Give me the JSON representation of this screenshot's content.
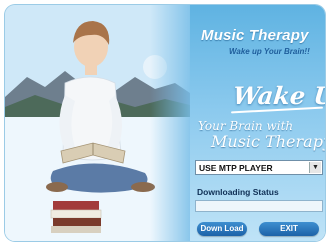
{
  "header": {
    "title": "Music Therapy",
    "subtitle": "Wake up Your Brain!!"
  },
  "slogan": {
    "headline": "Wake Up!",
    "line1": "Your Brain with",
    "line2": "Music Therapy"
  },
  "player_select": {
    "selected": "USE MTP PLAYER"
  },
  "status": {
    "label": "Downloading Status",
    "progress": 0
  },
  "buttons": {
    "download": "Down Load",
    "exit": "EXIT"
  },
  "colors": {
    "background_top": "#5fb3e2",
    "background_bottom": "#bfe3f7",
    "button": "#1c62a8",
    "title": "#ffffff",
    "subtitle": "#1f5e9c"
  }
}
